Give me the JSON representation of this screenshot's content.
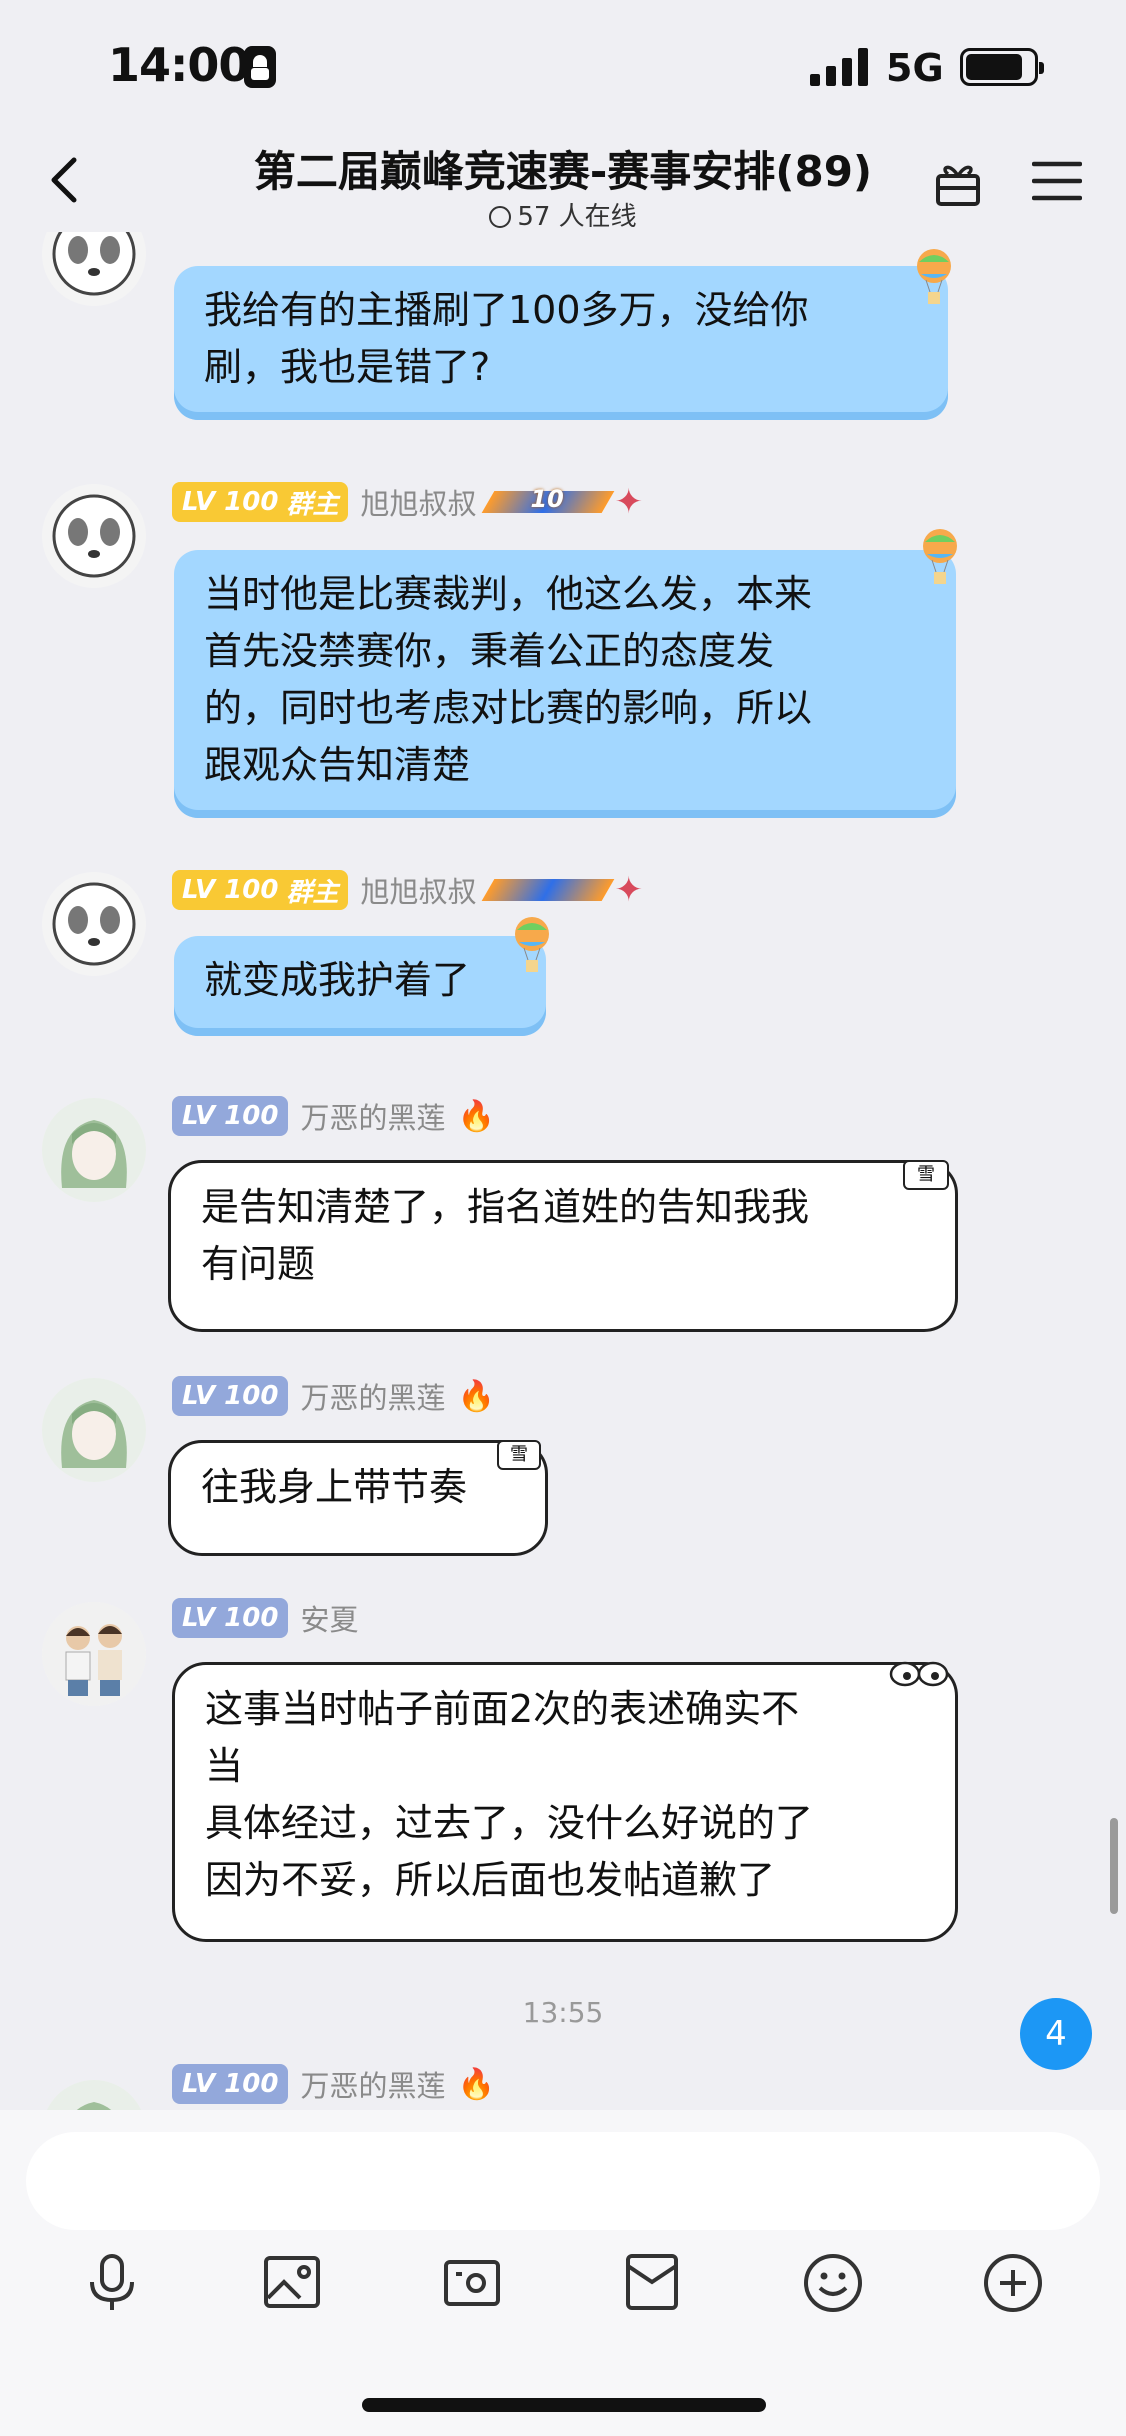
{
  "status_bar": {
    "time": "14:00",
    "network": "5G"
  },
  "header": {
    "title": "第二届巅峰竞速赛-赛事安排(89)",
    "online": "57 人在线",
    "icons": [
      "back-arrow-icon",
      "gift-box-icon",
      "menu-icon"
    ]
  },
  "messages": [
    {
      "id": "m1",
      "level": "LV 100",
      "role": "",
      "name": "",
      "text": "我给有的主播刷了100多万，没给你\n刷，我也是错了?",
      "bubble_style": "blue"
    },
    {
      "id": "m2",
      "level": "LV 100",
      "role": "群主",
      "name": "旭旭叔叔",
      "badge": "10",
      "text": "当时他是比赛裁判，他这么发，本来\n首先没禁赛你，秉着公正的态度发\n的，同时也考虑对比赛的影响，所以\n跟观众告知清楚",
      "bubble_style": "blue"
    },
    {
      "id": "m3",
      "level": "LV 100",
      "role": "群主",
      "name": "旭旭叔叔",
      "text": "就变成我护着了",
      "bubble_style": "blue"
    },
    {
      "id": "m4",
      "level": "LV 100",
      "name": "万恶的黑莲",
      "text": "是告知清楚了，指名道姓的告知我我\n有问题",
      "bubble_style": "white",
      "tag": "雪"
    },
    {
      "id": "m5",
      "level": "LV 100",
      "name": "万恶的黑莲",
      "text": "往我身上带节奏",
      "bubble_style": "white",
      "tag": "雪"
    },
    {
      "id": "m6",
      "level": "LV 100",
      "name": "安夏",
      "text": "这事当时帖子前面2次的表述确实不\n当\n具体经过，过去了，没什么好说的了\n因为不妥，所以后面也发帖道歉了",
      "bubble_style": "white"
    },
    {
      "id": "m7",
      "level": "LV 100",
      "name": "万恶的黑莲",
      "text": ""
    }
  ],
  "time_divider": "13:55",
  "unread_badge": "4",
  "composer": {
    "input_value": "",
    "tools": [
      "microphone-icon",
      "image-icon",
      "camera-icon",
      "red-packet-icon",
      "emoji-icon",
      "plus-icon"
    ]
  },
  "colors": {
    "blue_bubble": "#a3d7ff",
    "badge": "#1c97f5",
    "gold_level": "#f9c934",
    "blue_level": "#93a8db"
  }
}
